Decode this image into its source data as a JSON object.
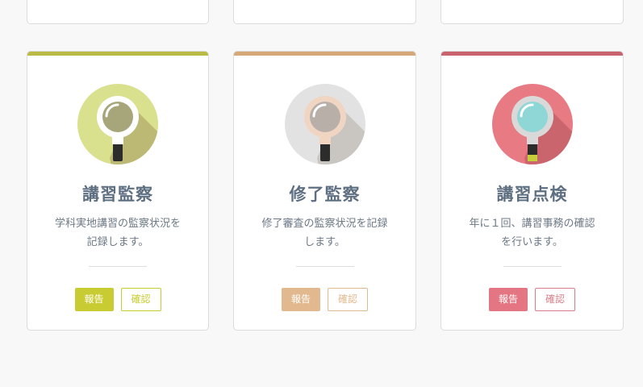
{
  "cards": [
    {
      "title": "講習監察",
      "desc_line1": "学科実地講習の監察状況を",
      "desc_line2": "記録します。",
      "report_label": "報告",
      "confirm_label": "確認",
      "accent_color": "#b9bb46",
      "circle_color": "#d9e18f",
      "button_color": "#c8cb32",
      "icon": "magnifier-icon"
    },
    {
      "title": "修了監察",
      "desc_line1": "修了審査の監察状況を記録",
      "desc_line2": "します。",
      "report_label": "報告",
      "confirm_label": "確認",
      "accent_color": "#d6a777",
      "circle_color": "#e2e2e2",
      "button_color": "#e2b88e",
      "icon": "magnifier-icon"
    },
    {
      "title": "講習点検",
      "desc_line1": "年に１回、講習事務の確認",
      "desc_line2": "を行います。",
      "report_label": "報告",
      "confirm_label": "確認",
      "accent_color": "#c9646f",
      "circle_color": "#e87a84",
      "button_color": "#e47582",
      "icon": "magnifier-icon"
    }
  ]
}
